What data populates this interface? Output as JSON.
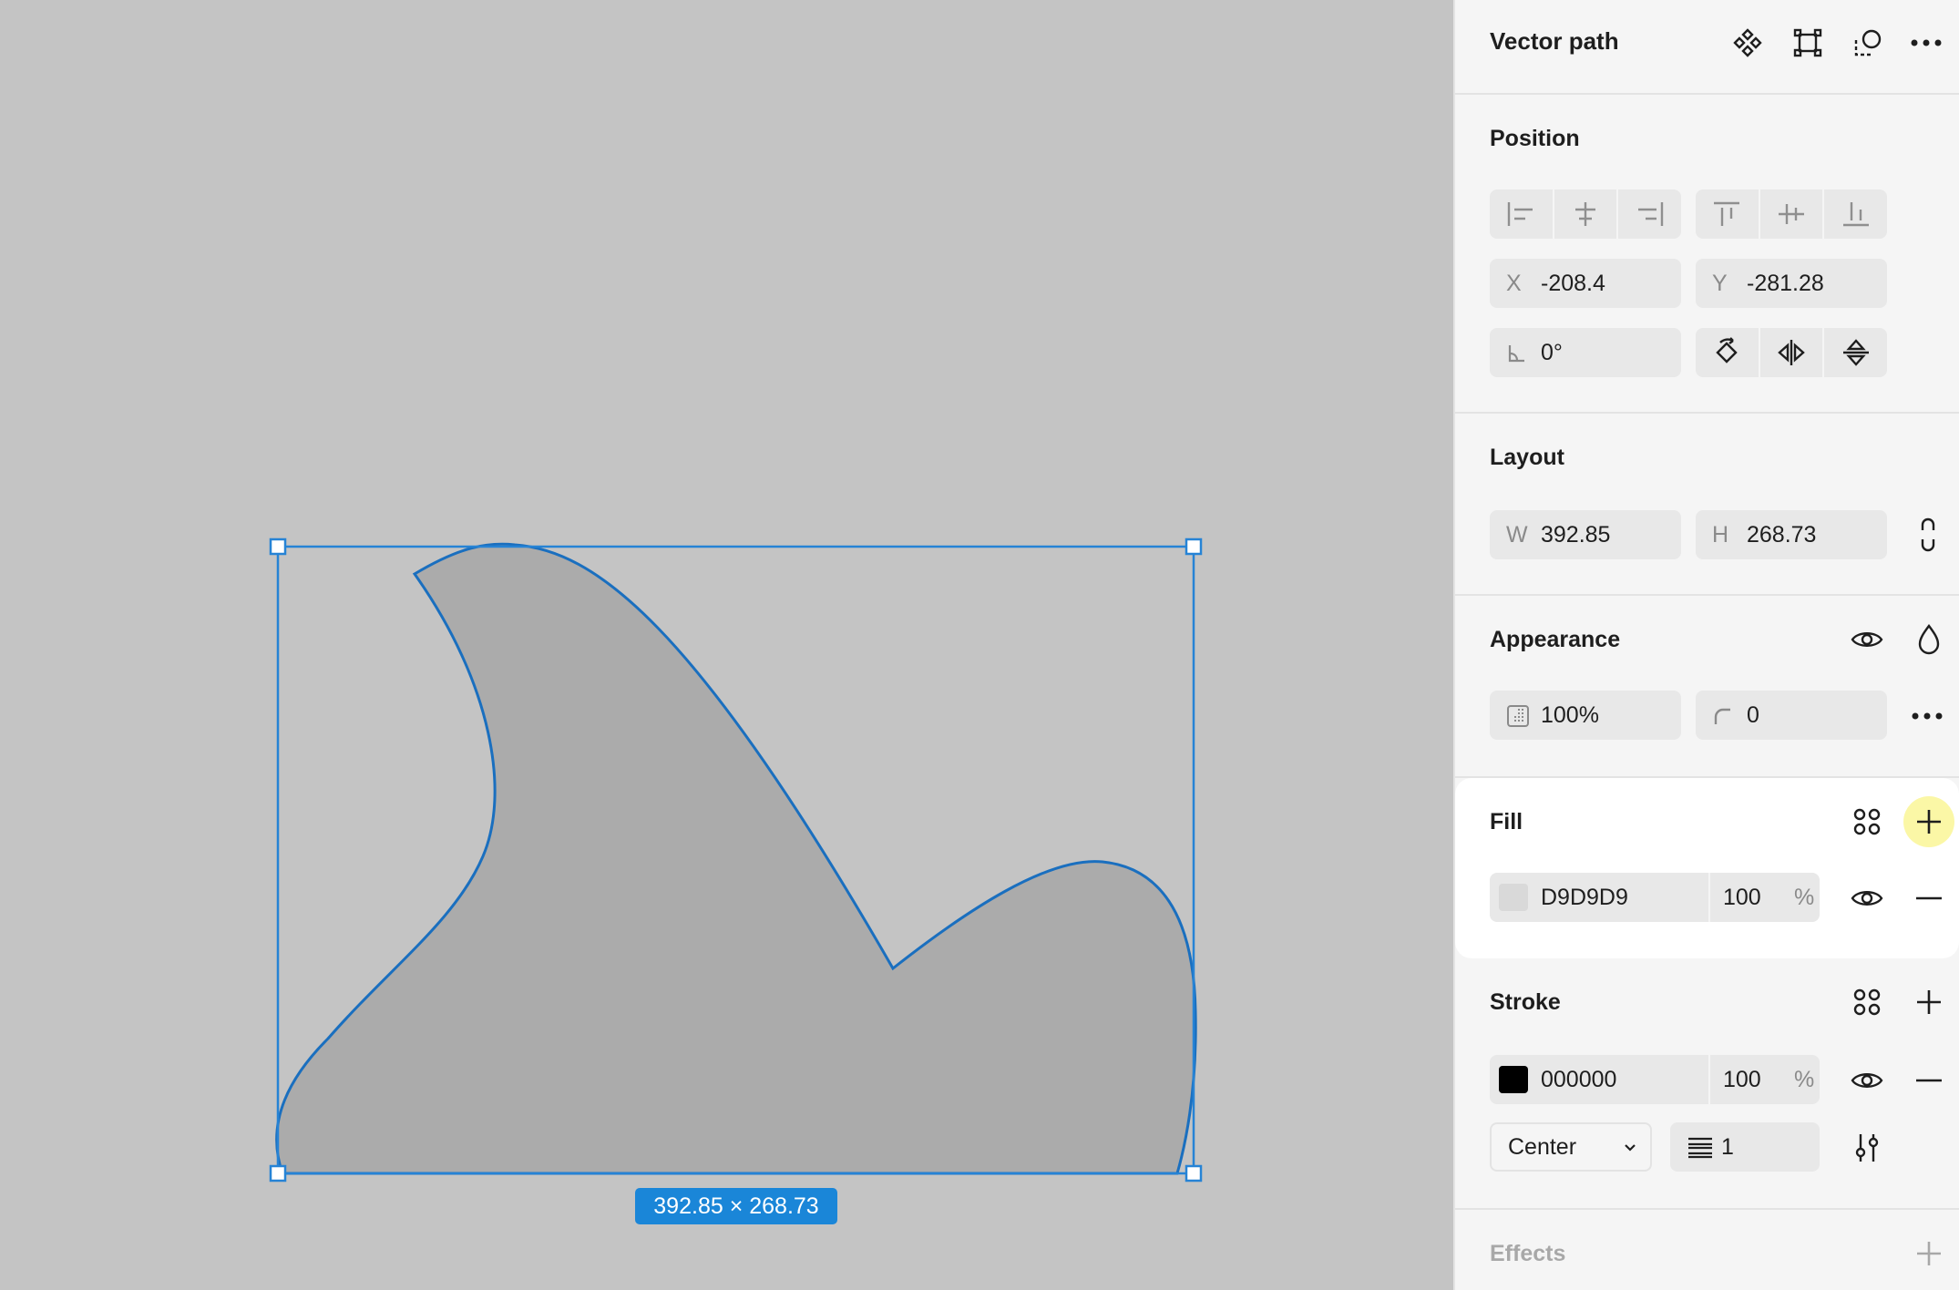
{
  "canvas": {
    "selection_size_label": "392.85 × 268.73",
    "shape_fill": "#ababab",
    "outline_color": "#1a6fbf",
    "selection_color": "#2683d5"
  },
  "panel": {
    "title": "Vector path",
    "position": {
      "title": "Position",
      "x_label": "X",
      "x_value": "-208.4",
      "y_label": "Y",
      "y_value": "-281.28",
      "rotation_value": "0°"
    },
    "layout": {
      "title": "Layout",
      "w_label": "W",
      "w_value": "392.85",
      "h_label": "H",
      "h_value": "268.73"
    },
    "appearance": {
      "title": "Appearance",
      "opacity_value": "100%",
      "radius_value": "0"
    },
    "fill": {
      "title": "Fill",
      "color_hex": "D9D9D9",
      "swatch": "#d9d9d9",
      "opacity": "100",
      "pct": "%"
    },
    "stroke": {
      "title": "Stroke",
      "color_hex": "000000",
      "swatch": "#000000",
      "opacity": "100",
      "pct": "%",
      "align": "Center",
      "weight": "1"
    },
    "effects": {
      "title": "Effects"
    }
  }
}
